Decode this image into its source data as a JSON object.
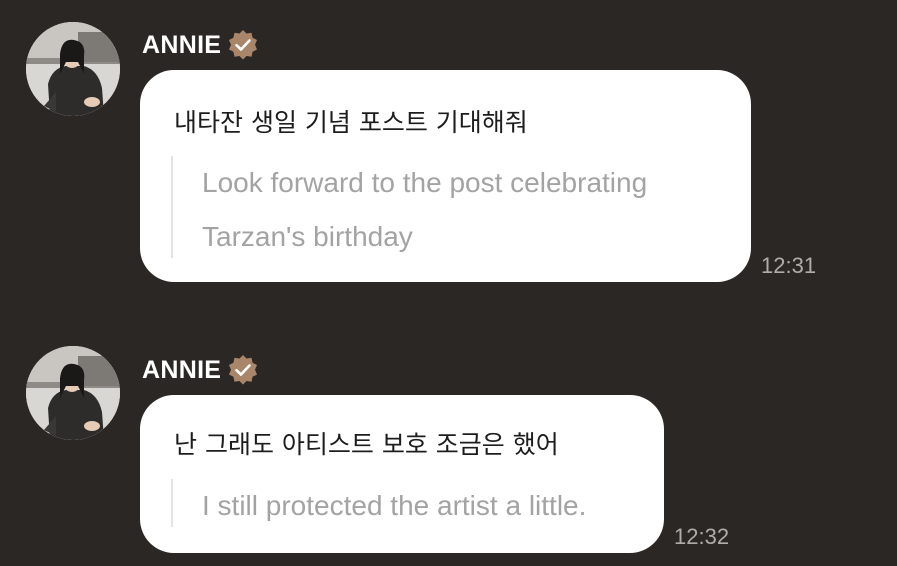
{
  "colors": {
    "background": "#2b2724",
    "bubble": "#ffffff",
    "verified_badge": "#a9856a",
    "translation_text": "#a3a3a3",
    "timestamp": "#b1aca6"
  },
  "messages": [
    {
      "sender": "ANNIE",
      "verified_icon": "verified-check-badge",
      "avatar_icon": "profile-photo",
      "text": "내타잔 생일 기념 포스트 기대해줘",
      "translation_lines": [
        "Look forward to the post celebrating",
        "Tarzan's birthday"
      ],
      "time": "12:31"
    },
    {
      "sender": "ANNIE",
      "verified_icon": "verified-check-badge",
      "avatar_icon": "profile-photo",
      "text": "난 그래도 아티스트 보호 조금은 했어",
      "translation_lines": [
        "I still protected the artist a little."
      ],
      "time": "12:32"
    }
  ]
}
